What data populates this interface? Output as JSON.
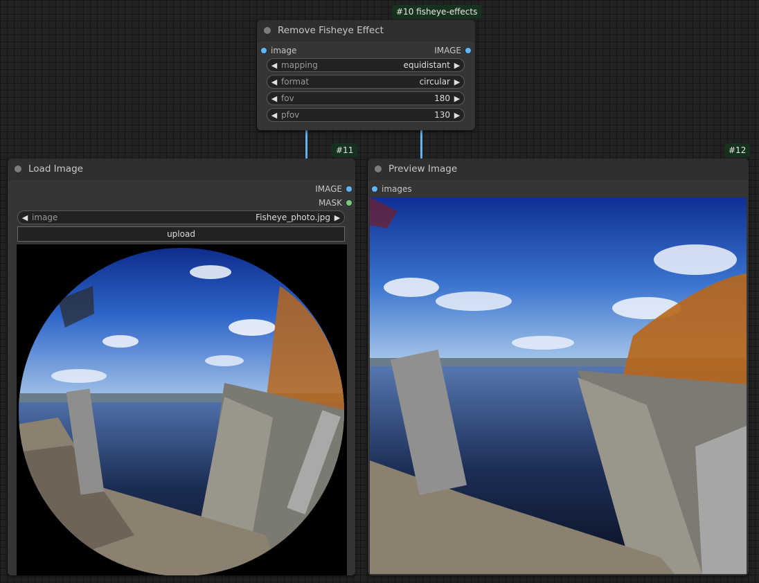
{
  "nodes": {
    "remove": {
      "badge": "#10 fisheye-effects",
      "title": "Remove Fisheye Effect",
      "input": "image",
      "output": "IMAGE",
      "widgets": [
        {
          "label": "mapping",
          "value": "equidistant"
        },
        {
          "label": "format",
          "value": "circular"
        },
        {
          "label": "fov",
          "value": "180"
        },
        {
          "label": "pfov",
          "value": "130"
        }
      ]
    },
    "load": {
      "badge": "#11",
      "title": "Load Image",
      "outputs": [
        "IMAGE",
        "MASK"
      ],
      "image_widget": {
        "label": "image",
        "value": "Fisheye_photo.jpg"
      },
      "upload_label": "upload"
    },
    "preview": {
      "badge": "#12",
      "title": "Preview Image",
      "input": "images"
    }
  },
  "icons": {
    "left": "triangle-left-icon",
    "right": "triangle-right-icon"
  },
  "colors": {
    "image_link": "#64b5f6",
    "mask_link": "#81c784",
    "badge_bg": "#16321d"
  }
}
